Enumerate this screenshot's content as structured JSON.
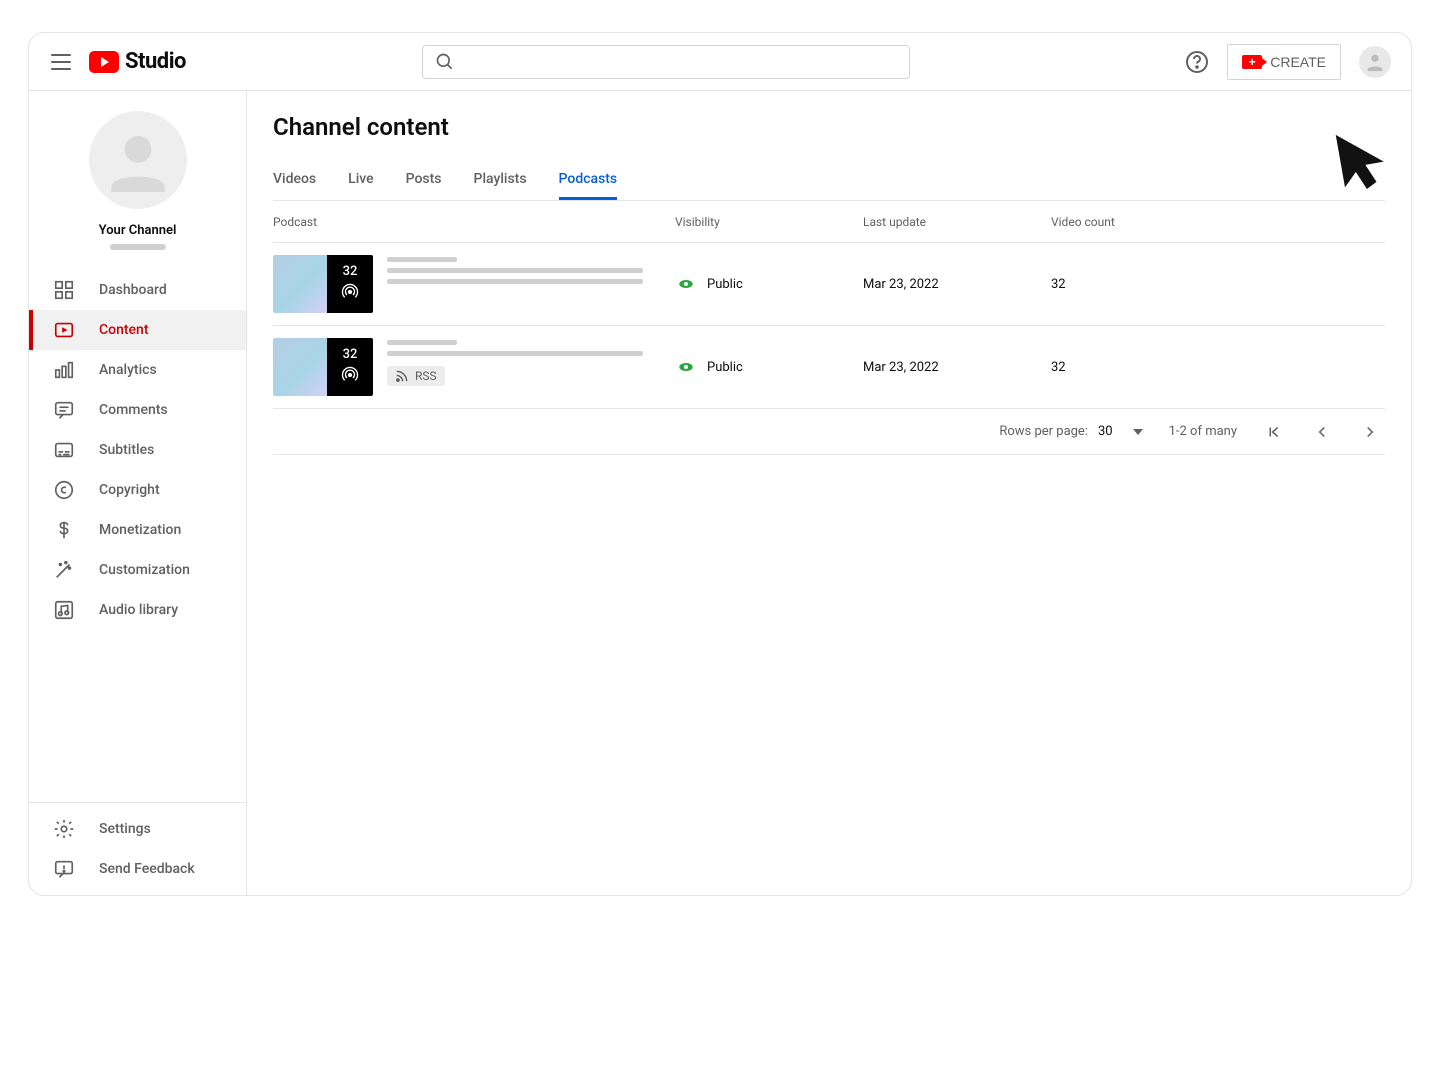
{
  "header": {
    "logo_text": "Studio",
    "search_placeholder": "",
    "create_label": "CREATE"
  },
  "sidebar": {
    "channel_name": "Your Channel",
    "items": [
      {
        "icon": "dashboard",
        "label": "Dashboard",
        "active": false
      },
      {
        "icon": "content",
        "label": "Content",
        "active": true
      },
      {
        "icon": "analytics",
        "label": "Analytics",
        "active": false
      },
      {
        "icon": "comments",
        "label": "Comments",
        "active": false
      },
      {
        "icon": "subtitles",
        "label": "Subtitles",
        "active": false
      },
      {
        "icon": "copyright",
        "label": "Copyright",
        "active": false
      },
      {
        "icon": "monetization",
        "label": "Monetization",
        "active": false
      },
      {
        "icon": "customization",
        "label": "Customization",
        "active": false
      },
      {
        "icon": "audio",
        "label": "Audio library",
        "active": false
      }
    ],
    "bottom_items": [
      {
        "icon": "settings",
        "label": "Settings"
      },
      {
        "icon": "feedback",
        "label": "Send Feedback"
      }
    ]
  },
  "main": {
    "title": "Channel content",
    "tabs": [
      "Videos",
      "Live",
      "Posts",
      "Playlists",
      "Podcasts"
    ],
    "active_tab": 4,
    "columns": [
      "Podcast",
      "Visibility",
      "Last update",
      "Video count"
    ],
    "rows": [
      {
        "badge_count": "32",
        "visibility": "Public",
        "last_update": "Mar 23, 2022",
        "video_count": "32",
        "rss": false
      },
      {
        "badge_count": "32",
        "visibility": "Public",
        "last_update": "Mar 23, 2022",
        "video_count": "32",
        "rss": true,
        "rss_label": "RSS"
      }
    ],
    "pager": {
      "rows_per_page_label": "Rows per page:",
      "rows_per_page_value": "30",
      "range": "1-2 of many"
    }
  }
}
